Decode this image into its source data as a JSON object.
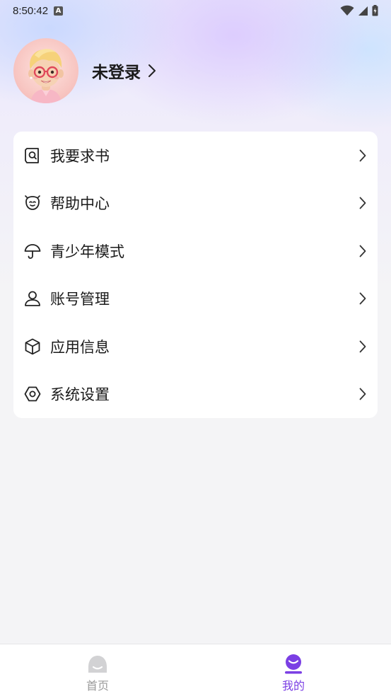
{
  "status_bar": {
    "time": "8:50:42",
    "notification_badge": "A"
  },
  "profile": {
    "name": "未登录"
  },
  "menu": {
    "items": [
      {
        "label": "我要求书",
        "icon": "book-search-icon"
      },
      {
        "label": "帮助中心",
        "icon": "help-face-icon"
      },
      {
        "label": "青少年模式",
        "icon": "umbrella-icon"
      },
      {
        "label": "账号管理",
        "icon": "user-icon"
      },
      {
        "label": "应用信息",
        "icon": "cube-icon"
      },
      {
        "label": "系统设置",
        "icon": "settings-hex-icon"
      }
    ]
  },
  "bottom_nav": {
    "items": [
      {
        "label": "首页",
        "icon": "home-icon",
        "active": false
      },
      {
        "label": "我的",
        "icon": "profile-icon",
        "active": true
      }
    ]
  },
  "colors": {
    "accent": "#7b3fe4",
    "inactive": "#9a9a9a",
    "text": "#1a1a1a"
  }
}
